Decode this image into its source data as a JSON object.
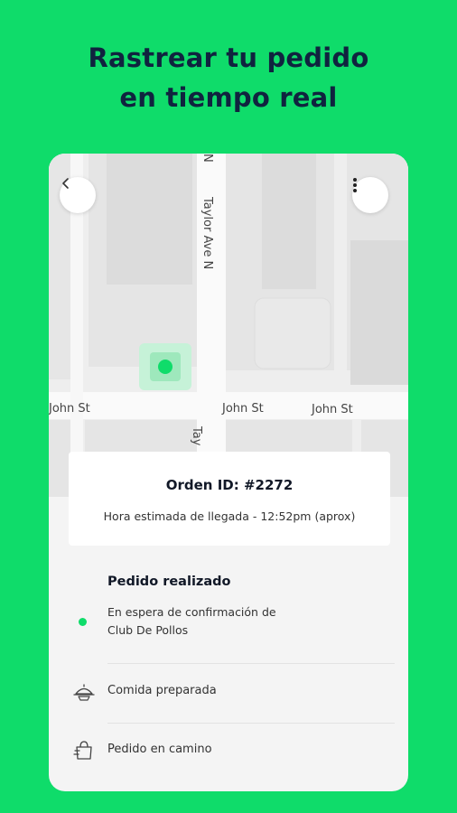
{
  "headline": {
    "line1": "Rastrear tu pedido",
    "line2": "en tiempo real"
  },
  "map": {
    "streets": {
      "vertical_name": "Taylor Ave N",
      "vertical_top_fragment": "N",
      "vertical_bottom_fragment": "Tay",
      "horizontal_name": "John St"
    },
    "back_icon": "chevron-left-icon",
    "menu_icon": "more-vertical-icon",
    "location_marker_color": "#0fdc6a"
  },
  "order": {
    "id_label": "Orden ID: #2272",
    "eta_label": "Hora estimada de llegada - 12:52pm (aprox)"
  },
  "status": {
    "current_title": "Pedido realizado",
    "current_desc_line1": "En espera de confirmación de",
    "current_desc_line2": "Club De Pollos",
    "step2_label": "Comida preparada",
    "step2_icon": "food-tray-icon",
    "step3_label": "Pedido en camino",
    "step3_icon": "shopping-bag-icon"
  },
  "colors": {
    "background": "#0fdc6a",
    "headline": "#10233f",
    "accent": "#0fdc6a"
  }
}
